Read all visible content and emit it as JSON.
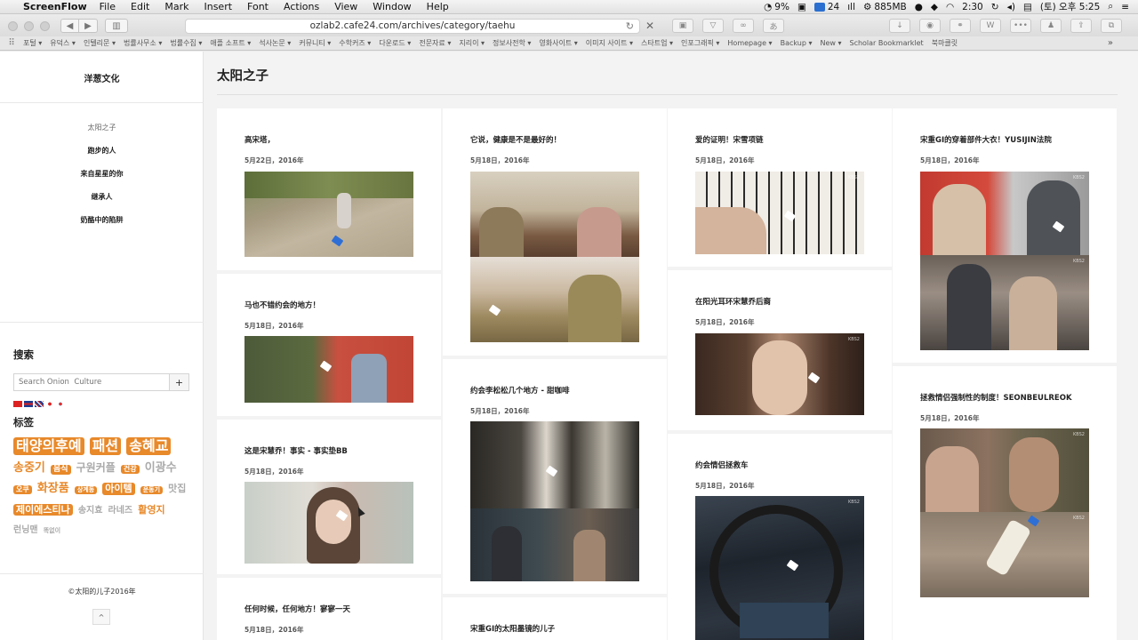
{
  "menubar": {
    "app": "ScreenFlow",
    "items": [
      "File",
      "Edit",
      "Mark",
      "Insert",
      "Font",
      "Actions",
      "View",
      "Window",
      "Help"
    ],
    "status": {
      "cpu": "9%",
      "mail": "24",
      "memory": "885MB",
      "time": "2:30",
      "datetime": "(토) 오후 5:25"
    }
  },
  "browser": {
    "url": "ozlab2.cafe24.com/archives/category/taehu",
    "bookmarks": [
      "포털",
      "유덕스",
      "인텔리문",
      "법률사무소",
      "법률수집",
      "애플 소프트",
      "석사논문",
      "커뮤니티",
      "수학커즈",
      "다운로드",
      "전문자료",
      "지리이",
      "정보사전학",
      "영화사이트",
      "이미지 사이트",
      "스타트업",
      "인포그래픽",
      "Homepage",
      "Backup",
      "New",
      "Scholar Bookmarklet",
      "북마클릿"
    ]
  },
  "sidebar": {
    "site_title": "洋葱文化",
    "nav": [
      "太阳之子",
      "跑步的人",
      "来自星星的你",
      "继承人",
      "奶酪中的陷阱"
    ],
    "search_heading": "搜索",
    "search_placeholder": "Search Onion  Culture",
    "search_button": "+",
    "tags_heading": "标签",
    "tags": [
      {
        "text": "태양의후예",
        "style": "hl",
        "size": 16
      },
      {
        "text": "패션",
        "style": "hl",
        "size": 16
      },
      {
        "text": "송혜교",
        "style": "hl",
        "size": 16
      },
      {
        "text": "송중기",
        "style": "o",
        "size": 13
      },
      {
        "text": "음식",
        "style": "hl",
        "size": 9
      },
      {
        "text": "구원커플",
        "style": "g",
        "size": 12
      },
      {
        "text": "건강",
        "style": "hl",
        "size": 8
      },
      {
        "text": "이광수",
        "style": "g",
        "size": 13
      },
      {
        "text": "오쿠",
        "style": "hl",
        "size": 8
      },
      {
        "text": "화장품",
        "style": "o",
        "size": 13
      },
      {
        "text": "상계동",
        "style": "hl",
        "size": 7
      },
      {
        "text": "아이템",
        "style": "hl",
        "size": 11
      },
      {
        "text": "운동기",
        "style": "hl",
        "size": 7
      },
      {
        "text": "맛집",
        "style": "g",
        "size": 11
      },
      {
        "text": "제이에스티나",
        "style": "hl",
        "size": 11
      },
      {
        "text": "송지효",
        "style": "g",
        "size": 10
      },
      {
        "text": "라네즈",
        "style": "g",
        "size": 10
      },
      {
        "text": "활영지",
        "style": "o",
        "size": 11
      },
      {
        "text": "런닝맨",
        "style": "g",
        "size": 10
      },
      {
        "text": "똑없이",
        "style": "g",
        "size": 7
      }
    ],
    "copyright": "©太阳的儿子2016年",
    "to_top": "^"
  },
  "main": {
    "title": "太阳之子",
    "columns": [
      [
        {
          "title": "高宋塔，",
          "date": "5月22日，2016年"
        },
        {
          "title": "马也不错约会的地方！",
          "date": "5月18日，2016年"
        },
        {
          "title": "这是宋慧乔！事实 - 事实垫BB",
          "date": "5月18日，2016年"
        },
        {
          "title": "任何时候，任何地方！寥寥一天",
          "date": "5月18日，2016年"
        }
      ],
      [
        {
          "title": "它说，健康是不是最好的！",
          "date": "5月18日，2016年"
        },
        {
          "title": "约会李松松几个地方 - 甜咖啡",
          "date": "5月18日，2016年"
        },
        {
          "title": "宋重GI的太阳墨镜的儿子",
          "date": ""
        }
      ],
      [
        {
          "title": "爱的证明！宋雪项链",
          "date": "5月18日，2016年"
        },
        {
          "title": "在阳光耳环宋慧乔后裔",
          "date": "5月18日，2016年"
        },
        {
          "title": "约会情侣拯救车",
          "date": "5月18日，2016年"
        }
      ],
      [
        {
          "title": "宋重GI的穿着部件大衣！YUSIJIN法院",
          "date": "5月18日，2016年"
        },
        {
          "title": "拯救情侣强制性的制度！SEONBEULREOK",
          "date": "5月18日，2016年"
        }
      ]
    ],
    "watermark": "KBS2"
  },
  "colors": {
    "accent_tag": "#e8892a",
    "tag_blue": "#2e6fd6"
  }
}
